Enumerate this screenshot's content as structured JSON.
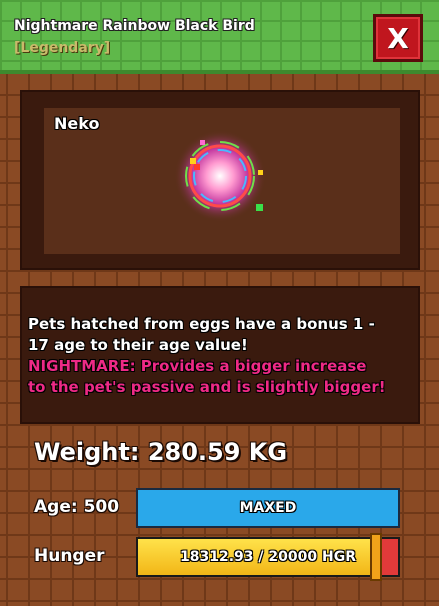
{
  "header": {
    "title": "Nightmare Rainbow Black Bird",
    "rarity": "[Legendary]",
    "close_label": "X"
  },
  "viewer": {
    "pet_name": "Neko"
  },
  "description": {
    "line1": "Pets hatched from eggs have a bonus 1 -",
    "line2": "17 age to their age value!",
    "line3": "NIGHTMARE: Provides a bigger increase",
    "line4": "to the pet's passive and is slightly bigger!"
  },
  "stats": {
    "weight": "Weight: 280.59 KG",
    "age_label": "Age: 500",
    "age_status": "MAXED",
    "hunger_label": "Hunger",
    "hunger_text": "18312.93 / 20000 HGR",
    "hunger_fraction": 0.9156
  },
  "colors": {
    "header_green": "#5fb84a",
    "close_red": "#c0161e",
    "nightmare_pink": "#ee2a86",
    "age_blue": "#2aa8ea",
    "hunger_yellow": "#f2b617"
  }
}
